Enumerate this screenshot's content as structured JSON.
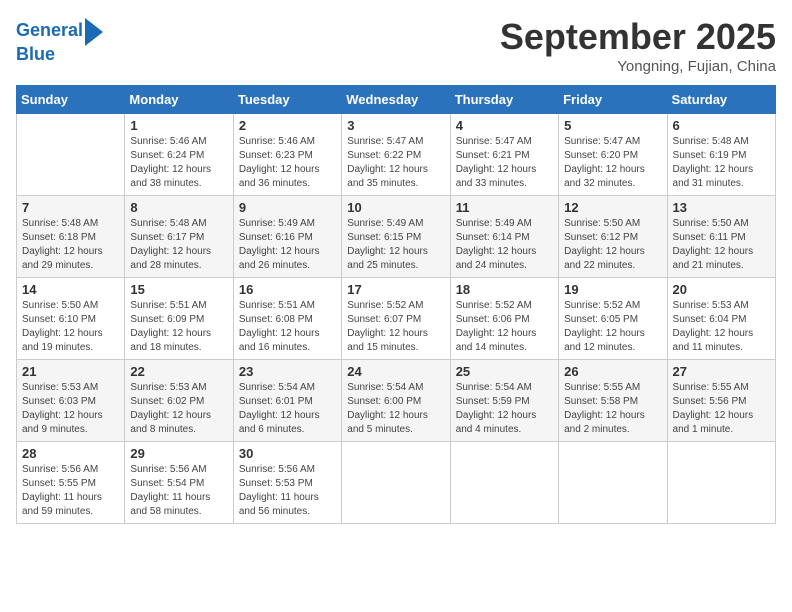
{
  "header": {
    "logo_line1": "General",
    "logo_line2": "Blue",
    "month": "September 2025",
    "location": "Yongning, Fujian, China"
  },
  "days_of_week": [
    "Sunday",
    "Monday",
    "Tuesday",
    "Wednesday",
    "Thursday",
    "Friday",
    "Saturday"
  ],
  "weeks": [
    [
      {
        "day": "",
        "content": ""
      },
      {
        "day": "1",
        "content": "Sunrise: 5:46 AM\nSunset: 6:24 PM\nDaylight: 12 hours\nand 38 minutes."
      },
      {
        "day": "2",
        "content": "Sunrise: 5:46 AM\nSunset: 6:23 PM\nDaylight: 12 hours\nand 36 minutes."
      },
      {
        "day": "3",
        "content": "Sunrise: 5:47 AM\nSunset: 6:22 PM\nDaylight: 12 hours\nand 35 minutes."
      },
      {
        "day": "4",
        "content": "Sunrise: 5:47 AM\nSunset: 6:21 PM\nDaylight: 12 hours\nand 33 minutes."
      },
      {
        "day": "5",
        "content": "Sunrise: 5:47 AM\nSunset: 6:20 PM\nDaylight: 12 hours\nand 32 minutes."
      },
      {
        "day": "6",
        "content": "Sunrise: 5:48 AM\nSunset: 6:19 PM\nDaylight: 12 hours\nand 31 minutes."
      }
    ],
    [
      {
        "day": "7",
        "content": "Sunrise: 5:48 AM\nSunset: 6:18 PM\nDaylight: 12 hours\nand 29 minutes."
      },
      {
        "day": "8",
        "content": "Sunrise: 5:48 AM\nSunset: 6:17 PM\nDaylight: 12 hours\nand 28 minutes."
      },
      {
        "day": "9",
        "content": "Sunrise: 5:49 AM\nSunset: 6:16 PM\nDaylight: 12 hours\nand 26 minutes."
      },
      {
        "day": "10",
        "content": "Sunrise: 5:49 AM\nSunset: 6:15 PM\nDaylight: 12 hours\nand 25 minutes."
      },
      {
        "day": "11",
        "content": "Sunrise: 5:49 AM\nSunset: 6:14 PM\nDaylight: 12 hours\nand 24 minutes."
      },
      {
        "day": "12",
        "content": "Sunrise: 5:50 AM\nSunset: 6:12 PM\nDaylight: 12 hours\nand 22 minutes."
      },
      {
        "day": "13",
        "content": "Sunrise: 5:50 AM\nSunset: 6:11 PM\nDaylight: 12 hours\nand 21 minutes."
      }
    ],
    [
      {
        "day": "14",
        "content": "Sunrise: 5:50 AM\nSunset: 6:10 PM\nDaylight: 12 hours\nand 19 minutes."
      },
      {
        "day": "15",
        "content": "Sunrise: 5:51 AM\nSunset: 6:09 PM\nDaylight: 12 hours\nand 18 minutes."
      },
      {
        "day": "16",
        "content": "Sunrise: 5:51 AM\nSunset: 6:08 PM\nDaylight: 12 hours\nand 16 minutes."
      },
      {
        "day": "17",
        "content": "Sunrise: 5:52 AM\nSunset: 6:07 PM\nDaylight: 12 hours\nand 15 minutes."
      },
      {
        "day": "18",
        "content": "Sunrise: 5:52 AM\nSunset: 6:06 PM\nDaylight: 12 hours\nand 14 minutes."
      },
      {
        "day": "19",
        "content": "Sunrise: 5:52 AM\nSunset: 6:05 PM\nDaylight: 12 hours\nand 12 minutes."
      },
      {
        "day": "20",
        "content": "Sunrise: 5:53 AM\nSunset: 6:04 PM\nDaylight: 12 hours\nand 11 minutes."
      }
    ],
    [
      {
        "day": "21",
        "content": "Sunrise: 5:53 AM\nSunset: 6:03 PM\nDaylight: 12 hours\nand 9 minutes."
      },
      {
        "day": "22",
        "content": "Sunrise: 5:53 AM\nSunset: 6:02 PM\nDaylight: 12 hours\nand 8 minutes."
      },
      {
        "day": "23",
        "content": "Sunrise: 5:54 AM\nSunset: 6:01 PM\nDaylight: 12 hours\nand 6 minutes."
      },
      {
        "day": "24",
        "content": "Sunrise: 5:54 AM\nSunset: 6:00 PM\nDaylight: 12 hours\nand 5 minutes."
      },
      {
        "day": "25",
        "content": "Sunrise: 5:54 AM\nSunset: 5:59 PM\nDaylight: 12 hours\nand 4 minutes."
      },
      {
        "day": "26",
        "content": "Sunrise: 5:55 AM\nSunset: 5:58 PM\nDaylight: 12 hours\nand 2 minutes."
      },
      {
        "day": "27",
        "content": "Sunrise: 5:55 AM\nSunset: 5:56 PM\nDaylight: 12 hours\nand 1 minute."
      }
    ],
    [
      {
        "day": "28",
        "content": "Sunrise: 5:56 AM\nSunset: 5:55 PM\nDaylight: 11 hours\nand 59 minutes."
      },
      {
        "day": "29",
        "content": "Sunrise: 5:56 AM\nSunset: 5:54 PM\nDaylight: 11 hours\nand 58 minutes."
      },
      {
        "day": "30",
        "content": "Sunrise: 5:56 AM\nSunset: 5:53 PM\nDaylight: 11 hours\nand 56 minutes."
      },
      {
        "day": "",
        "content": ""
      },
      {
        "day": "",
        "content": ""
      },
      {
        "day": "",
        "content": ""
      },
      {
        "day": "",
        "content": ""
      }
    ]
  ]
}
